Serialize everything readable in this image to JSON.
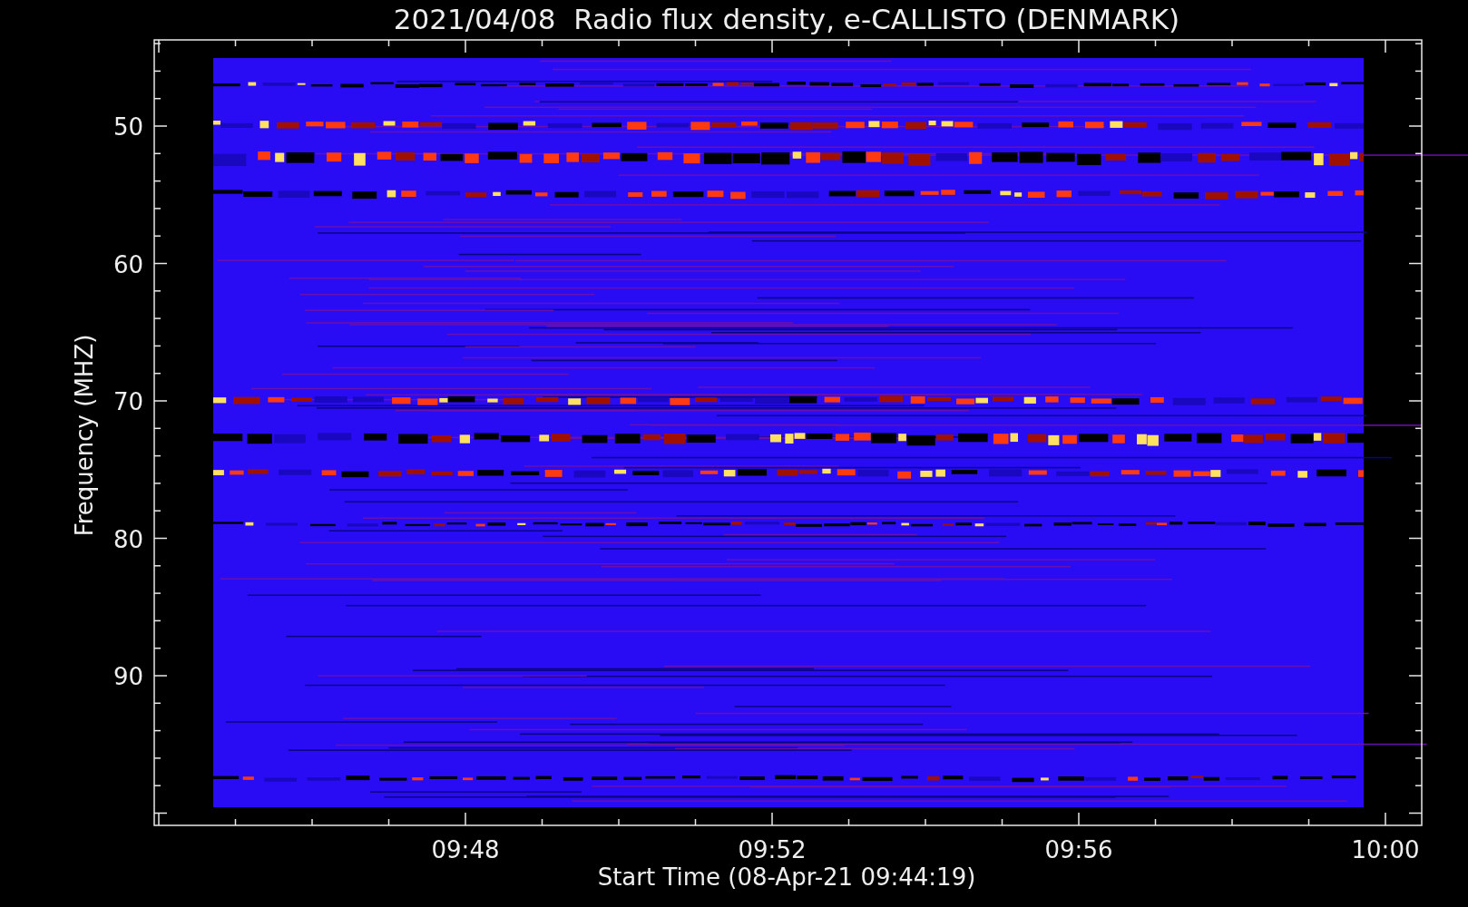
{
  "title": "2021/04/08  Radio flux density, e-CALLISTO (DENMARK)",
  "y_axis": {
    "label": "Frequency (MHZ)",
    "ticks": [
      "50",
      "60",
      "70",
      "80",
      "90"
    ]
  },
  "x_axis": {
    "label": "Start Time (08-Apr-21 09:44:19)",
    "ticks": [
      "09:48",
      "09:52",
      "09:56",
      "10:00"
    ]
  }
}
